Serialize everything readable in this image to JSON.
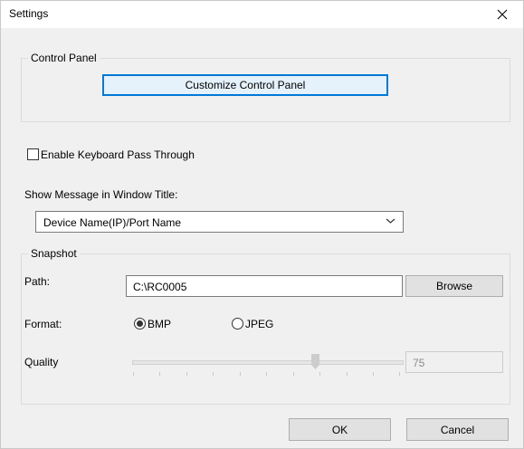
{
  "window": {
    "title": "Settings"
  },
  "control_panel": {
    "group_label": "Control Panel",
    "customize_button": "Customize Control Panel"
  },
  "keyboard": {
    "pass_through_label": "Enable Keyboard Pass Through",
    "checked": false
  },
  "message": {
    "label": "Show Message in Window Title:",
    "selected": "Device Name(IP)/Port Name"
  },
  "snapshot": {
    "group_label": "Snapshot",
    "path_label": "Path:",
    "path_value": "C:\\RC0005",
    "browse_button": "Browse",
    "format_label": "Format:",
    "format_options": [
      "BMP",
      "JPEG"
    ],
    "format_selected": "BMP",
    "quality_label": "Quality",
    "quality_value": "75"
  },
  "footer": {
    "ok": "OK",
    "cancel": "Cancel"
  },
  "icons": {
    "close": "close-icon",
    "chevron": "chevron-down-icon"
  }
}
